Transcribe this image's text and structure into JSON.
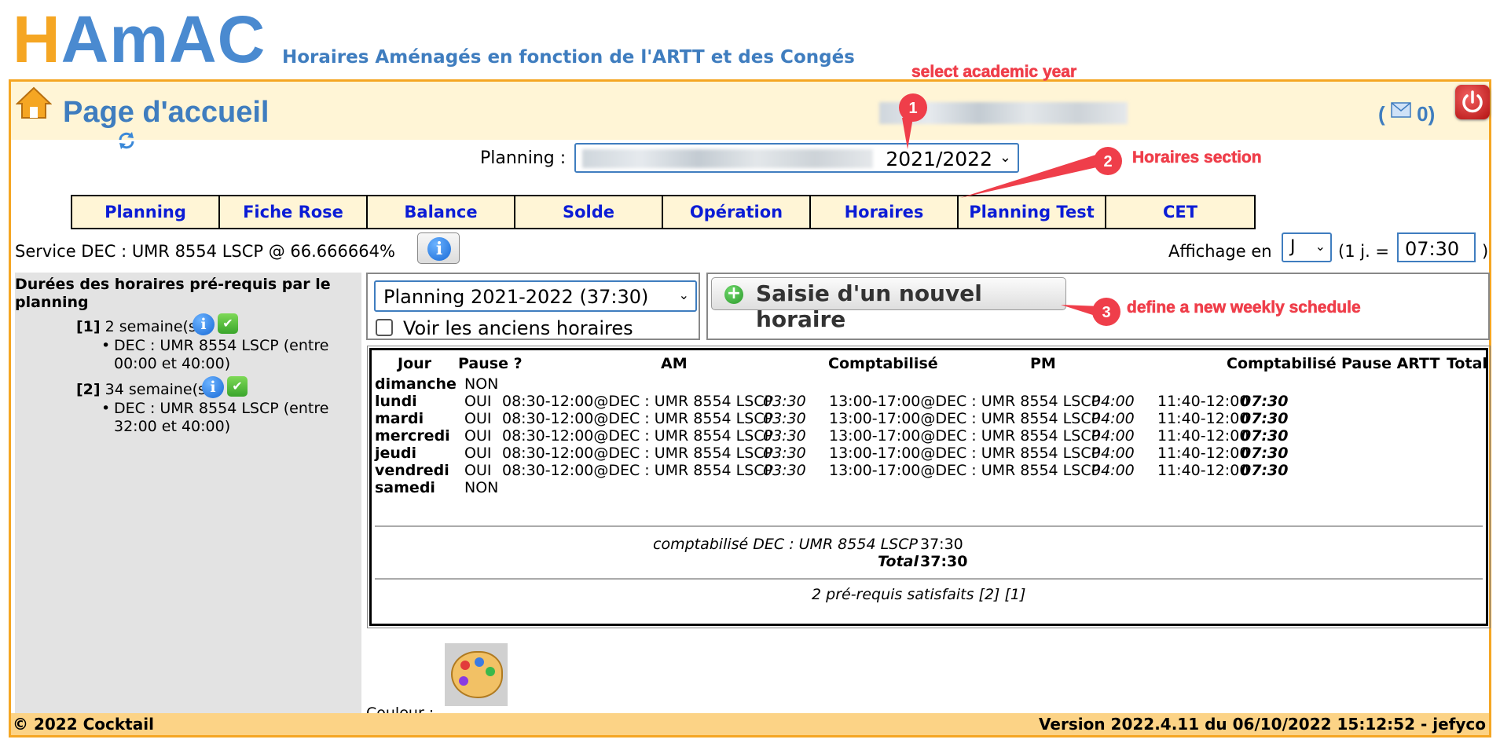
{
  "header": {
    "logo_h": "H",
    "logo_rest": "AmAC",
    "subtitle": "Horaires Aménagés en fonction de l'ARTT et des Congés"
  },
  "annotations": {
    "a1": "select academic year",
    "a2": "Horaires section",
    "a3": "define a new weekly schedule",
    "n1": "1",
    "n2": "2",
    "n3": "3",
    "color": "#ef3e4a"
  },
  "topbar": {
    "title": "Page d'accueil",
    "mail_open": "(",
    "mail_count": "0)"
  },
  "planning": {
    "label": "Planning :",
    "selected_year": "2021/2022"
  },
  "tabs": [
    "Planning",
    "Fiche Rose",
    "Balance",
    "Solde",
    "Opération",
    "Horaires",
    "Planning Test",
    "CET"
  ],
  "service": {
    "text": "Service DEC : UMR 8554 LSCP @ 66.666664%",
    "affichage_label": "Affichage en",
    "unit": "J",
    "per_day_label": "(1 j. =",
    "per_day_value": "07:30",
    "close": ")"
  },
  "sidebar": {
    "title": "Durées des horaires pré-requis par le planning",
    "items": [
      {
        "index": "[1]",
        "weeks": "2 semaine(s)",
        "detail": "DEC : UMR 8554 LSCP (entre 00:00 et 40:00)"
      },
      {
        "index": "[2]",
        "weeks": "34 semaine(s)",
        "detail": "DEC : UMR 8554 LSCP (entre 32:00 et 40:00)"
      }
    ]
  },
  "controls": {
    "horaire_selected": "Planning 2021-2022 (37:30)",
    "show_old_label": "Voir les anciens horaires",
    "new_button": "Saisie d'un nouvel horaire"
  },
  "table": {
    "headers": {
      "jour": "Jour",
      "pause": "Pause ?",
      "am": "AM",
      "comp1": "Comptabilisé",
      "pm": "PM",
      "comp2": "Comptabilisé",
      "pause_artt": "Pause ARTT",
      "total": "Total"
    },
    "rows": [
      {
        "day": "dimanche",
        "pause": "NON",
        "am": "",
        "comp_am": "",
        "pm": "",
        "comp_pm": "",
        "artt": "",
        "total": ""
      },
      {
        "day": "lundi",
        "pause": "OUI",
        "am": "08:30-12:00@DEC : UMR 8554 LSCP",
        "comp_am": "03:30",
        "pm": "13:00-17:00@DEC : UMR 8554 LSCP",
        "comp_pm": "04:00",
        "artt": "11:40-12:00",
        "total": "07:30"
      },
      {
        "day": "mardi",
        "pause": "OUI",
        "am": "08:30-12:00@DEC : UMR 8554 LSCP",
        "comp_am": "03:30",
        "pm": "13:00-17:00@DEC : UMR 8554 LSCP",
        "comp_pm": "04:00",
        "artt": "11:40-12:00",
        "total": "07:30"
      },
      {
        "day": "mercredi",
        "pause": "OUI",
        "am": "08:30-12:00@DEC : UMR 8554 LSCP",
        "comp_am": "03:30",
        "pm": "13:00-17:00@DEC : UMR 8554 LSCP",
        "comp_pm": "04:00",
        "artt": "11:40-12:00",
        "total": "07:30"
      },
      {
        "day": "jeudi",
        "pause": "OUI",
        "am": "08:30-12:00@DEC : UMR 8554 LSCP",
        "comp_am": "03:30",
        "pm": "13:00-17:00@DEC : UMR 8554 LSCP",
        "comp_pm": "04:00",
        "artt": "11:40-12:00",
        "total": "07:30"
      },
      {
        "day": "vendredi",
        "pause": "OUI",
        "am": "08:30-12:00@DEC : UMR 8554 LSCP",
        "comp_am": "03:30",
        "pm": "13:00-17:00@DEC : UMR 8554 LSCP",
        "comp_pm": "04:00",
        "artt": "11:40-12:00",
        "total": "07:30"
      },
      {
        "day": "samedi",
        "pause": "NON",
        "am": "",
        "comp_am": "",
        "pm": "",
        "comp_pm": "",
        "artt": "",
        "total": ""
      }
    ],
    "summary_label": "comptabilisé DEC : UMR 8554 LSCP",
    "summary_value": "37:30",
    "total_label": "Total",
    "total_value": "37:30",
    "prereq": "2 pré-requis satisfaits [2] [1]"
  },
  "colour": {
    "label": "Couleur :"
  },
  "footer": {
    "left": "© 2022 Cocktail",
    "right": "Version 2022.4.11 du 06/10/2022 15:12:52 - jefyco"
  }
}
